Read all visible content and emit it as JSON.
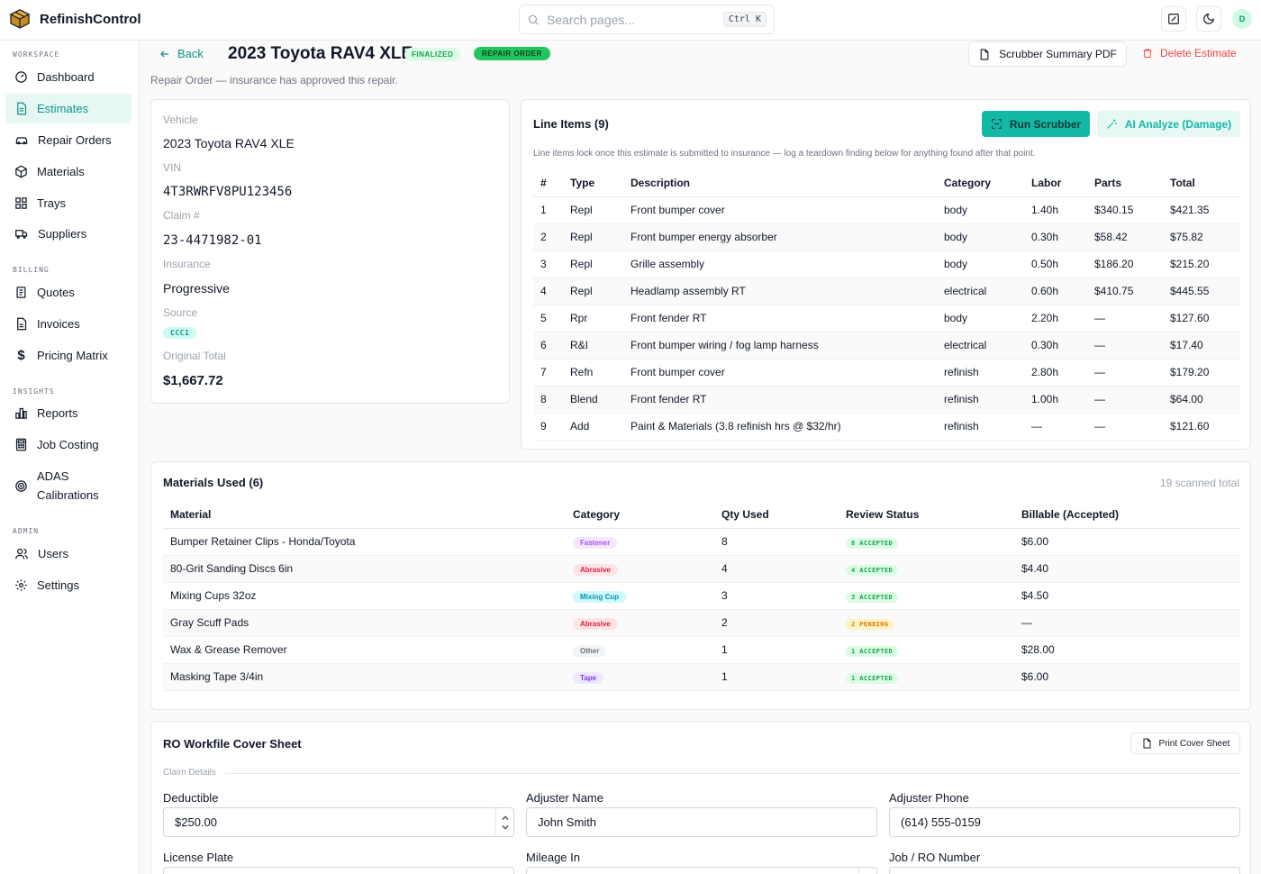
{
  "app": {
    "name": "RefinishControl",
    "avatar_initial": "D"
  },
  "search": {
    "placeholder": "Search pages...",
    "shortcut": "Ctrl K"
  },
  "sidebar": {
    "sections": [
      {
        "label": "WORKSPACE"
      },
      {
        "label": "BILLING"
      },
      {
        "label": "INSIGHTS"
      },
      {
        "label": "ADMIN"
      }
    ],
    "items": [
      {
        "label": "Dashboard",
        "icon": "gauge-icon"
      },
      {
        "label": "Estimates",
        "icon": "document-icon",
        "active": true
      },
      {
        "label": "Repair Orders",
        "icon": "car-icon"
      },
      {
        "label": "Materials",
        "icon": "box-icon"
      },
      {
        "label": "Trays",
        "icon": "grid-icon"
      },
      {
        "label": "Suppliers",
        "icon": "truck-icon"
      },
      {
        "label": "Quotes",
        "icon": "clipboard-icon"
      },
      {
        "label": "Invoices",
        "icon": "file-icon"
      },
      {
        "label": "Pricing Matrix",
        "icon": "dollar-icon"
      },
      {
        "label": "Reports",
        "icon": "bar-chart-icon"
      },
      {
        "label": "Job Costing",
        "icon": "calculator-icon"
      },
      {
        "label": "ADAS Calibrations",
        "icon": "target-icon"
      },
      {
        "label": "Users",
        "icon": "users-icon"
      },
      {
        "label": "Settings",
        "icon": "gear-icon"
      }
    ]
  },
  "header": {
    "back_label": "Back",
    "title": "2023 Toyota RAV4 XLE",
    "badge_finalized": "FINALIZED",
    "badge_repair_order": "REPAIR ORDER",
    "subtitle": "Repair Order — insurance has approved this repair.",
    "pdf_button": "Scrubber Summary PDF",
    "delete_button": "Delete Estimate"
  },
  "vehicle": {
    "vehicle_label": "Vehicle",
    "vehicle_value": "2023 Toyota RAV4 XLE",
    "vin_label": "VIN",
    "vin_value": "4T3RWRFV8PU123456",
    "claim_label": "Claim #",
    "claim_value": "23-4471982-01",
    "insurance_label": "Insurance",
    "insurance_value": "Progressive",
    "source_label": "Source",
    "source_value": "CCC1",
    "total_label": "Original Total",
    "total_value": "$1,667.72"
  },
  "line_items": {
    "title": "Line Items (9)",
    "run_scrubber": "Run Scrubber",
    "ai_analyze": "AI Analyze (Damage)",
    "note": "Line items lock once this estimate is submitted to insurance — log a teardown finding below for anything found after that point.",
    "columns": [
      "#",
      "Type",
      "Description",
      "Category",
      "Labor",
      "Parts",
      "Total"
    ],
    "rows": [
      {
        "num": "1",
        "type": "Repl",
        "desc": "Front bumper cover",
        "cat": "body",
        "labor": "1.40h",
        "parts": "$340.15",
        "total": "$421.35"
      },
      {
        "num": "2",
        "type": "Repl",
        "desc": "Front bumper energy absorber",
        "cat": "body",
        "labor": "0.30h",
        "parts": "$58.42",
        "total": "$75.82"
      },
      {
        "num": "3",
        "type": "Repl",
        "desc": "Grille assembly",
        "cat": "body",
        "labor": "0.50h",
        "parts": "$186.20",
        "total": "$215.20"
      },
      {
        "num": "4",
        "type": "Repl",
        "desc": "Headlamp assembly RT",
        "cat": "electrical",
        "labor": "0.60h",
        "parts": "$410.75",
        "total": "$445.55"
      },
      {
        "num": "5",
        "type": "Rpr",
        "desc": "Front fender RT",
        "cat": "body",
        "labor": "2.20h",
        "parts": "—",
        "total": "$127.60"
      },
      {
        "num": "6",
        "type": "R&I",
        "desc": "Front bumper wiring / fog lamp harness",
        "cat": "electrical",
        "labor": "0.30h",
        "parts": "—",
        "total": "$17.40"
      },
      {
        "num": "7",
        "type": "Refn",
        "desc": "Front bumper cover",
        "cat": "refinish",
        "labor": "2.80h",
        "parts": "—",
        "total": "$179.20"
      },
      {
        "num": "8",
        "type": "Blend",
        "desc": "Front fender RT",
        "cat": "refinish",
        "labor": "1.00h",
        "parts": "—",
        "total": "$64.00"
      },
      {
        "num": "9",
        "type": "Add",
        "desc": "Paint & Materials (3.8 refinish hrs @ $32/hr)",
        "cat": "refinish",
        "labor": "—",
        "parts": "—",
        "total": "$121.60"
      }
    ]
  },
  "materials": {
    "title": "Materials Used (6)",
    "scanned_total": "19 scanned total",
    "columns": [
      "Material",
      "Category",
      "Qty Used",
      "Review Status",
      "Billable (Accepted)"
    ],
    "rows": [
      {
        "name": "Bumper Retainer Clips - Honda/Toyota",
        "cat": "Fastener",
        "cat_color": "#a855f7",
        "cat_bg": "#f3e8ff",
        "qty": "8",
        "status": "8 ACCEPTED",
        "status_color": "#16a34a",
        "status_bg": "#dcfce7",
        "billable": "$6.00"
      },
      {
        "name": "80-Grit Sanding Discs 6in",
        "cat": "Abrasive",
        "cat_color": "#e11d48",
        "cat_bg": "#ffe4e6",
        "qty": "4",
        "status": "4 ACCEPTED",
        "status_color": "#16a34a",
        "status_bg": "#dcfce7",
        "billable": "$4.40"
      },
      {
        "name": "Mixing Cups 32oz",
        "cat": "Mixing Cup",
        "cat_color": "#0891b2",
        "cat_bg": "#cffafe",
        "qty": "3",
        "status": "3 ACCEPTED",
        "status_color": "#16a34a",
        "status_bg": "#dcfce7",
        "billable": "$4.50"
      },
      {
        "name": "Gray Scuff Pads",
        "cat": "Abrasive",
        "cat_color": "#e11d48",
        "cat_bg": "#ffe4e6",
        "qty": "2",
        "status": "2 PENDING",
        "status_color": "#d97706",
        "status_bg": "#fef3c7",
        "billable": "—"
      },
      {
        "name": "Wax & Grease Remover",
        "cat": "Other",
        "cat_color": "#6b7280",
        "cat_bg": "#f3f4f6",
        "qty": "1",
        "status": "1 ACCEPTED",
        "status_color": "#16a34a",
        "status_bg": "#dcfce7",
        "billable": "$28.00"
      },
      {
        "name": "Masking Tape 3/4in",
        "cat": "Tape",
        "cat_color": "#7c3aed",
        "cat_bg": "#ede9fe",
        "qty": "1",
        "status": "1 ACCEPTED",
        "status_color": "#16a34a",
        "status_bg": "#dcfce7",
        "billable": "$6.00"
      }
    ]
  },
  "cover_sheet": {
    "title": "RO Workfile Cover Sheet",
    "print_button": "Print Cover Sheet",
    "claim_details": "Claim Details",
    "deductible_label": "Deductible",
    "deductible_value": "$250.00",
    "adjuster_name_label": "Adjuster Name",
    "adjuster_name_value": "John Smith",
    "adjuster_phone_label": "Adjuster Phone",
    "adjuster_phone_value": "(614) 555-0159",
    "license_plate_label": "License Plate",
    "mileage_label": "Mileage In",
    "job_number_label": "Job / RO Number"
  },
  "colors": {
    "accent": "#14b8a6",
    "danger": "#ef4444",
    "success": "#22c55e"
  }
}
